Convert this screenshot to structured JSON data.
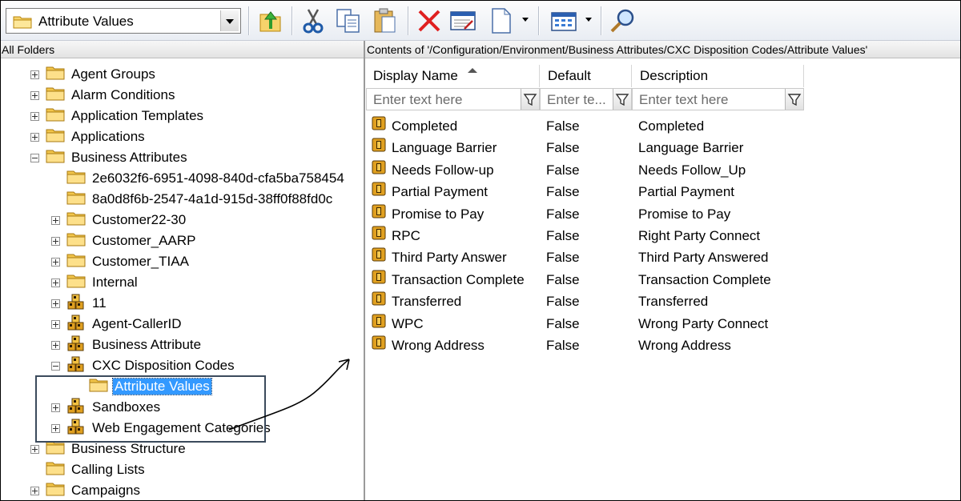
{
  "toolbar": {
    "folder_selector_value": "Attribute Values",
    "buttons": [
      {
        "name": "up-one-level",
        "icon": "folder-up-icon"
      },
      {
        "name": "cut",
        "icon": "scissors-icon"
      },
      {
        "name": "copy",
        "icon": "copy-icon"
      },
      {
        "name": "paste",
        "icon": "paste-icon"
      },
      {
        "name": "delete",
        "icon": "red-x-icon"
      },
      {
        "name": "properties",
        "icon": "properties-icon"
      },
      {
        "name": "new",
        "icon": "new-document-icon"
      },
      {
        "name": "view",
        "icon": "grid-view-icon"
      },
      {
        "name": "find",
        "icon": "magnifier-icon"
      }
    ]
  },
  "left_pane": {
    "header": "All Folders",
    "tree": [
      {
        "label": "Agent Groups",
        "level": 0,
        "expander": "plus",
        "icon": "folder"
      },
      {
        "label": "Alarm Conditions",
        "level": 0,
        "expander": "plus",
        "icon": "folder"
      },
      {
        "label": "Application Templates",
        "level": 0,
        "expander": "plus",
        "icon": "folder"
      },
      {
        "label": "Applications",
        "level": 0,
        "expander": "plus",
        "icon": "folder"
      },
      {
        "label": "Business Attributes",
        "level": 0,
        "expander": "minus",
        "icon": "folder"
      },
      {
        "label": "2e6032f6-6951-4098-840d-cfa5ba758454",
        "level": 1,
        "expander": "none",
        "icon": "folder"
      },
      {
        "label": "8a0d8f6b-2547-4a1d-915d-38ff0f88fd0c",
        "level": 1,
        "expander": "none",
        "icon": "folder"
      },
      {
        "label": "Customer22-30",
        "level": 1,
        "expander": "plus",
        "icon": "folder"
      },
      {
        "label": "Customer_AARP",
        "level": 1,
        "expander": "plus",
        "icon": "folder"
      },
      {
        "label": "Customer_TIAA",
        "level": 1,
        "expander": "plus",
        "icon": "folder"
      },
      {
        "label": "Internal",
        "level": 1,
        "expander": "plus",
        "icon": "folder"
      },
      {
        "label": "11",
        "level": 1,
        "expander": "plus",
        "icon": "blocks"
      },
      {
        "label": "Agent-CallerID",
        "level": 1,
        "expander": "plus",
        "icon": "blocks"
      },
      {
        "label": "Business Attribute",
        "level": 1,
        "expander": "plus",
        "icon": "blocks"
      },
      {
        "label": "CXC Disposition Codes",
        "level": 1,
        "expander": "minus",
        "icon": "blocks"
      },
      {
        "label": "Attribute Values",
        "level": 2,
        "expander": "none",
        "icon": "folder",
        "selected": true
      },
      {
        "label": "Sandboxes",
        "level": 1,
        "expander": "plus",
        "icon": "blocks"
      },
      {
        "label": "Web Engagement Categories",
        "level": 1,
        "expander": "plus",
        "icon": "blocks"
      },
      {
        "label": "Business Structure",
        "level": 0,
        "expander": "plus",
        "icon": "folder"
      },
      {
        "label": "Calling Lists",
        "level": 0,
        "expander": "none",
        "icon": "folder"
      },
      {
        "label": "Campaigns",
        "level": 0,
        "expander": "plus",
        "icon": "folder"
      }
    ]
  },
  "right_pane": {
    "header": "Contents of '/Configuration/Environment/Business Attributes/CXC Disposition Codes/Attribute Values'",
    "columns": [
      "Display Name",
      "Default",
      "Description"
    ],
    "filter_placeholders": [
      "Enter text here",
      "Enter te...",
      "Enter text here"
    ],
    "rows": [
      {
        "name": "Completed",
        "default": "False",
        "description": "Completed"
      },
      {
        "name": "Language Barrier",
        "default": "False",
        "description": "Language Barrier"
      },
      {
        "name": "Needs Follow-up",
        "default": "False",
        "description": "Needs Follow_Up"
      },
      {
        "name": "Partial Payment",
        "default": "False",
        "description": "Partial Payment"
      },
      {
        "name": "Promise to Pay",
        "default": "False",
        "description": "Promise to Pay"
      },
      {
        "name": "RPC",
        "default": "False",
        "description": "Right Party Connect"
      },
      {
        "name": "Third Party Answer",
        "default": "False",
        "description": "Third Party Answered"
      },
      {
        "name": "Transaction Complete",
        "default": "False",
        "description": "Transaction Complete"
      },
      {
        "name": "Transferred",
        "default": "False",
        "description": "Transferred"
      },
      {
        "name": "WPC",
        "default": "False",
        "description": "Wrong Party Connect"
      },
      {
        "name": "Wrong Address",
        "default": "False",
        "description": "Wrong Address"
      }
    ]
  },
  "colors": {
    "selection": "#3399ff",
    "folder": "#f4c94f",
    "delete": "#e02020"
  }
}
